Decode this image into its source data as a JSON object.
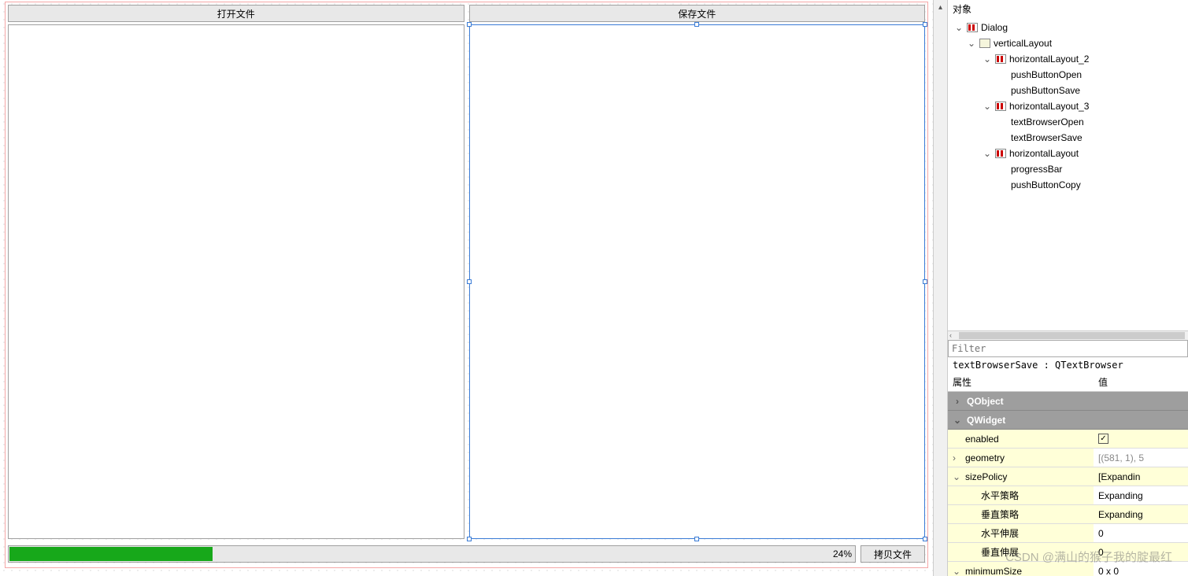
{
  "designer": {
    "buttons": {
      "open": "打开文件",
      "save": "保存文件",
      "copy": "拷贝文件"
    },
    "progress": {
      "percent": 24,
      "text": "24%"
    }
  },
  "objectInspector": {
    "header": "对象",
    "tree": {
      "dialog": "Dialog",
      "verticalLayout": "verticalLayout",
      "hl2": "horizontalLayout_2",
      "pushButtonOpen": "pushButtonOpen",
      "pushButtonSave": "pushButtonSave",
      "hl3": "horizontalLayout_3",
      "textBrowserOpen": "textBrowserOpen",
      "textBrowserSave": "textBrowserSave",
      "hl1": "horizontalLayout",
      "progressBar": "progressBar",
      "pushButtonCopy": "pushButtonCopy"
    }
  },
  "filter": {
    "placeholder": "Filter"
  },
  "selectedObject": "textBrowserSave : QTextBrowser",
  "propHeader": {
    "name": "属性",
    "value": "值"
  },
  "propGroups": {
    "qobject": "QObject",
    "qwidget": "QWidget"
  },
  "props": {
    "enabled": {
      "label": "enabled",
      "checked": true
    },
    "geometry": {
      "label": "geometry",
      "value": "[(581, 1), 5"
    },
    "sizePolicy": {
      "label": "sizePolicy",
      "value": "[Expandin"
    },
    "hPolicy": {
      "label": "水平策略",
      "value": "Expanding"
    },
    "vPolicy": {
      "label": "垂直策略",
      "value": "Expanding"
    },
    "hStretch": {
      "label": "水平伸展",
      "value": "0"
    },
    "vStretch": {
      "label": "垂直伸展",
      "value": "0"
    },
    "minimumSize": {
      "label": "minimumSize",
      "value": "0 x 0"
    }
  },
  "watermark": "CSDN @满山的猴子我的腚最红"
}
